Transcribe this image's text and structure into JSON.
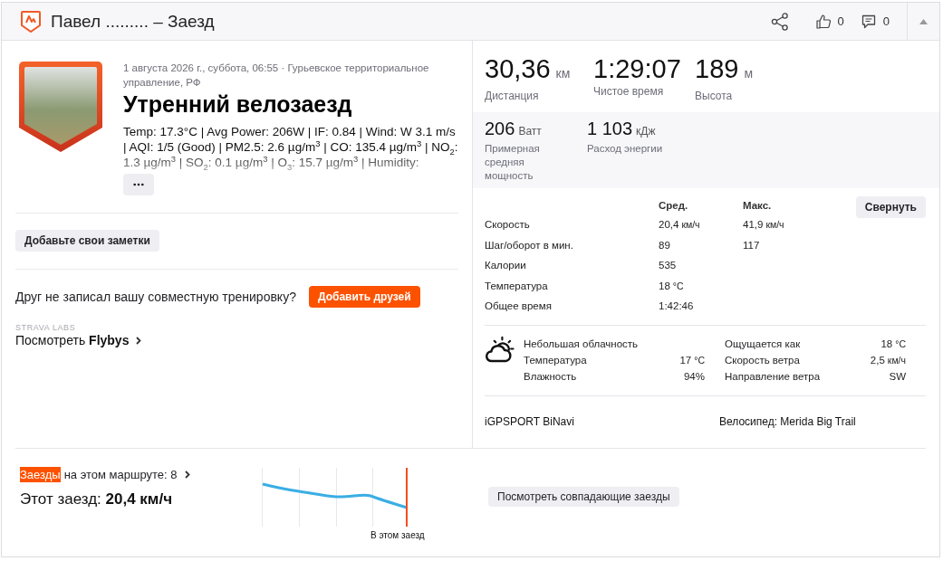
{
  "header": {
    "title": "Павел ......... – Заезд",
    "kudos": "0",
    "comments": "0"
  },
  "activity": {
    "meta": "1 августа 2026 г., суббота, 06:55 · Гурьевское территориальное управление, РФ",
    "title": "Утренний велозаезд",
    "description": "Temp: 17.3°C | Avg Power: 206W | IF: 0.84 | Wind: W 3.1 m/s | AQI: 1/5 (Good) | PM2.5: 2.6 µg/m$^{3}$ | CO: 135.4 µg/m$^{3}$ | NO$_{2}$: 1.3 µg/m$^{3}$ | SO$_{2}$: 0.1 µg/m$^{3}$ | O$_{3}$: 15.7 µg/m$^{3}$ | Humidity:"
  },
  "notes_button": "Добавьте свои заметки",
  "friends": {
    "prompt": "Друг не записал вашу совместную тренировку?",
    "button": "Добавить друзей"
  },
  "labs": {
    "caption": "STRAVA LABS",
    "link": "Посмотреть **Flybys**"
  },
  "primary_stats": [
    {
      "value": "30,36",
      "unit": "км",
      "label": "Дистанция"
    },
    {
      "value": "1:29:07",
      "label": "Чистое время"
    },
    {
      "value": "189",
      "unit": "м",
      "label": "Высота"
    }
  ],
  "secondary_stats": [
    {
      "value": "206",
      "unit": "Ватт",
      "label": "Примерная средняя мощность"
    },
    {
      "value": "1 103",
      "unit": "кДж",
      "label": "Расход энергии"
    }
  ],
  "stats_table": {
    "columns": [
      "Сред.",
      "Макс."
    ],
    "collapse_button": "Свернуть",
    "rows": [
      {
        "label": "Скорость",
        "avg": "20,4",
        "avg_unit": "км/ч",
        "max": "41,9",
        "max_unit": "км/ч"
      },
      {
        "label": "Шаг/оборот в мин.",
        "avg": "89",
        "max": "117"
      },
      {
        "label": "Калории",
        "avg": "535"
      },
      {
        "label": "Температура",
        "avg": "18",
        "avg_unit": "°C"
      },
      {
        "label": "Общее время",
        "avg": "1:42:46"
      }
    ]
  },
  "weather": {
    "condition": "Небольшая облачность",
    "left": [
      {
        "label": "Температура",
        "value": "17",
        "unit": "°C"
      },
      {
        "label": "Влажность",
        "value": "94%"
      }
    ],
    "right": [
      {
        "label": "Ощущается как",
        "value": "18",
        "unit": "°C"
      },
      {
        "label": "Скорость ветра",
        "value": "2,5",
        "unit": "км/ч"
      },
      {
        "label": "Направление ветра",
        "value": "SW"
      }
    ]
  },
  "gear": {
    "device": "iGPSPORT BiNavi",
    "bike": "Велосипед: Merida Big Trail"
  },
  "matched_rides": {
    "highlight": "Заезды",
    "link": "на этом маршруте: 8",
    "this_ride": "Этот заезд: **20,4 км/ч**",
    "chart_label": "В этом заезд",
    "button": "Посмотреть совпадающие заезды"
  }
}
